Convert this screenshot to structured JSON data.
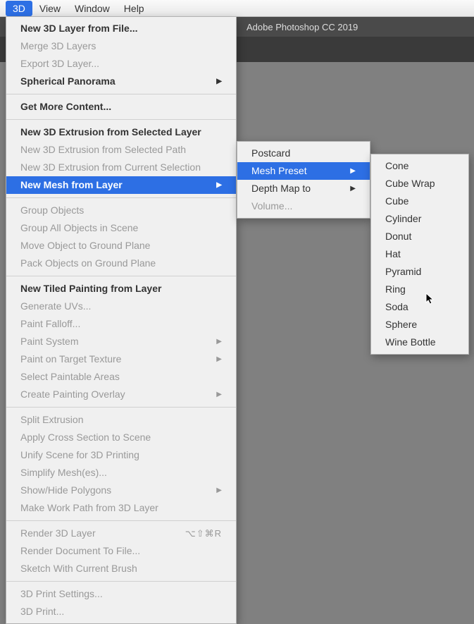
{
  "menubar": {
    "items": [
      "3D",
      "View",
      "Window",
      "Help"
    ],
    "active_index": 0
  },
  "titlebar": {
    "text": "Adobe Photoshop CC 2019"
  },
  "dropdown": {
    "groups": [
      [
        {
          "label": "New 3D Layer from File...",
          "bold": true
        },
        {
          "label": "Merge 3D Layers",
          "disabled": true
        },
        {
          "label": "Export 3D Layer...",
          "disabled": true
        },
        {
          "label": "Spherical Panorama",
          "bold": true,
          "arrow": true
        }
      ],
      [
        {
          "label": "Get More Content...",
          "bold": true
        }
      ],
      [
        {
          "label": "New 3D Extrusion from Selected Layer",
          "bold": true
        },
        {
          "label": "New 3D Extrusion from Selected Path",
          "disabled": true
        },
        {
          "label": "New 3D Extrusion from Current Selection",
          "disabled": true
        },
        {
          "label": "New Mesh from Layer",
          "bold": true,
          "arrow": true,
          "highlighted": true
        }
      ],
      [
        {
          "label": "Group Objects",
          "disabled": true
        },
        {
          "label": "Group All Objects in Scene",
          "disabled": true
        },
        {
          "label": "Move Object to Ground Plane",
          "disabled": true
        },
        {
          "label": "Pack Objects on Ground Plane",
          "disabled": true
        }
      ],
      [
        {
          "label": "New Tiled Painting from Layer",
          "bold": true
        },
        {
          "label": "Generate UVs...",
          "disabled": true
        },
        {
          "label": "Paint Falloff...",
          "disabled": true
        },
        {
          "label": "Paint System",
          "disabled": true,
          "arrow": true
        },
        {
          "label": "Paint on Target Texture",
          "disabled": true,
          "arrow": true
        },
        {
          "label": "Select Paintable Areas",
          "disabled": true
        },
        {
          "label": "Create Painting Overlay",
          "disabled": true,
          "arrow": true
        }
      ],
      [
        {
          "label": "Split Extrusion",
          "disabled": true
        },
        {
          "label": "Apply Cross Section to Scene",
          "disabled": true
        },
        {
          "label": "Unify Scene for 3D Printing",
          "disabled": true
        },
        {
          "label": "Simplify Mesh(es)...",
          "disabled": true
        },
        {
          "label": "Show/Hide Polygons",
          "disabled": true,
          "arrow": true
        },
        {
          "label": "Make Work Path from 3D Layer",
          "disabled": true
        }
      ],
      [
        {
          "label": "Render 3D Layer",
          "disabled": true,
          "shortcut": "⌥⇧⌘R"
        },
        {
          "label": "Render Document To File...",
          "disabled": true
        },
        {
          "label": "Sketch With Current Brush",
          "disabled": true
        }
      ],
      [
        {
          "label": "3D Print Settings...",
          "disabled": true
        },
        {
          "label": "3D Print...",
          "disabled": true
        }
      ]
    ]
  },
  "submenu1": {
    "items": [
      {
        "label": "Postcard"
      },
      {
        "label": "Mesh Preset",
        "arrow": true,
        "highlighted": true
      },
      {
        "label": "Depth Map to",
        "arrow": true
      },
      {
        "label": "Volume...",
        "disabled": true
      }
    ]
  },
  "submenu2": {
    "items": [
      "Cone",
      "Cube Wrap",
      "Cube",
      "Cylinder",
      "Donut",
      "Hat",
      "Pyramid",
      "Ring",
      "Soda",
      "Sphere",
      "Wine Bottle"
    ]
  }
}
